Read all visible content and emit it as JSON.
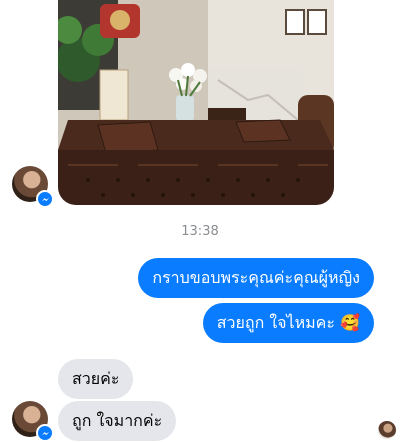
{
  "conversation": {
    "timestamp": "13:38",
    "outgoing": [
      {
        "text": "กราบขอบพระคุณค่ะคุณผู้หญิง"
      },
      {
        "text": "สวยถูก ใจไหมคะ",
        "emoji": "🥰"
      }
    ],
    "incoming": [
      {
        "text": "สวยค่ะ"
      },
      {
        "text": "ถูก ใจมากค่ะ"
      }
    ]
  },
  "icons": {
    "messenger_badge": "messenger-icon",
    "read_receipt": "seen-avatar"
  },
  "colors": {
    "outgoing_bubble": "#0a7cff",
    "incoming_bubble": "#e4e6eb",
    "timestamp_text": "#8a8d91"
  }
}
